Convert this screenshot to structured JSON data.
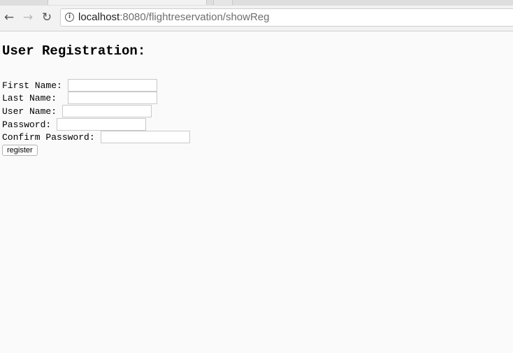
{
  "browser": {
    "url_host": "localhost",
    "url_path": ":8080/flightreservation/showReg",
    "back_icon": "arrow-left-icon",
    "forward_icon": "arrow-right-icon",
    "reload_icon": "reload-icon",
    "info_icon": "info-icon"
  },
  "page": {
    "heading": "User Registration:",
    "fields": [
      {
        "label": "First Name:",
        "value": ""
      },
      {
        "label": "Last Name:",
        "value": ""
      },
      {
        "label": "User Name:",
        "value": ""
      },
      {
        "label": "Password:",
        "value": ""
      },
      {
        "label": "Confirm Password:",
        "value": ""
      }
    ],
    "register_label": "register"
  }
}
